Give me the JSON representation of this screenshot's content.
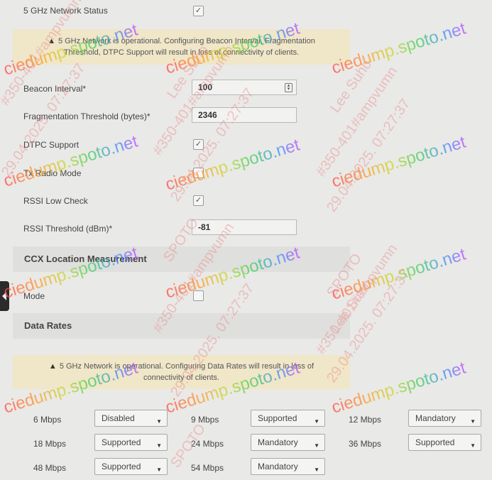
{
  "fields": {
    "net_status_label": "5 GHz Network Status",
    "beacon_label": "Beacon Interval*",
    "beacon_value": "100",
    "frag_label": "Fragmentation Threshold (bytes)*",
    "frag_value": "2346",
    "dtpc_label": "DTPC Support",
    "tx_label": "Tx Radio Mode",
    "rssi_check_label": "RSSI Low Check",
    "rssi_thr_label": "RSSI Threshold (dBm)*",
    "rssi_thr_value": "-81"
  },
  "warnings": {
    "beacon_warning_line1": "5 GHz Network is operational. Configuring Beacon Interval, Fragmentation",
    "beacon_warning_line2": "Threshold, DTPC Support will result in loss of connectivity of clients.",
    "rates_warning_line1": "5 GHz Network is operational. Configuring Data Rates will result in loss of",
    "rates_warning_line2": "connectivity of clients."
  },
  "sections": {
    "ccx_title": "CCX Location Measurement",
    "ccx_mode_label": "Mode",
    "rates_title": "Data Rates"
  },
  "rates": [
    {
      "label": "6 Mbps",
      "value": "Disabled"
    },
    {
      "label": "9 Mbps",
      "value": "Supported"
    },
    {
      "label": "12 Mbps",
      "value": "Mandatory"
    },
    {
      "label": "18 Mbps",
      "value": "Supported"
    },
    {
      "label": "24 Mbps",
      "value": "Mandatory"
    },
    {
      "label": "36 Mbps",
      "value": "Supported"
    },
    {
      "label": "48 Mbps",
      "value": "Supported"
    },
    {
      "label": "54 Mbps",
      "value": "Mandatory"
    }
  ],
  "icons": {
    "check": "✓",
    "warning": "▲",
    "caret": "▼"
  },
  "watermark": {
    "site": "ciedump.spoto.net",
    "stamp": "#350-401#ampvumn",
    "date": "29.04.2025. 07:27:37",
    "name": "Lee Suho",
    "brand": "SPOTO"
  }
}
